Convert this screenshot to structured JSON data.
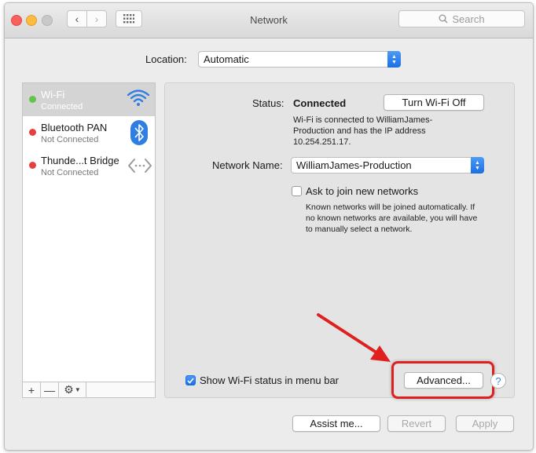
{
  "window": {
    "title": "Network"
  },
  "search": {
    "placeholder": "Search"
  },
  "location": {
    "label": "Location:",
    "value": "Automatic"
  },
  "services": [
    {
      "name": "Wi-Fi",
      "status": "Connected",
      "dot_color": "#5fc54b",
      "icon": "wifi-icon"
    },
    {
      "name": "Bluetooth PAN",
      "status": "Not Connected",
      "dot_color": "#e5403b",
      "icon": "bluetooth-icon"
    },
    {
      "name": "Thunde...t Bridge",
      "status": "Not Connected",
      "dot_color": "#e5403b",
      "icon": "thunderbolt-bridge-icon"
    }
  ],
  "sidebar_footer": {
    "add": "+",
    "remove": "—",
    "gear": "⚙︎"
  },
  "detail": {
    "status_label": "Status:",
    "status_value": "Connected",
    "turn_off_button": "Turn Wi-Fi Off",
    "status_desc": [
      "Wi-Fi is connected to WilliamJames-",
      "Production and has the IP address",
      "10.254.251.17."
    ],
    "network_name_label": "Network Name:",
    "network_name_value": "WilliamJames-Production",
    "ask_to_join_label": "Ask to join new networks",
    "ask_to_join_checked": false,
    "ask_desc": [
      "Known networks will be joined automatically. If",
      "no known networks are available, you will have",
      "to manually select a network."
    ],
    "show_status_label": "Show Wi-Fi status in menu bar",
    "show_status_checked": true,
    "advanced_button": "Advanced...",
    "help": "?"
  },
  "footer": {
    "assist": "Assist me...",
    "revert": "Revert",
    "apply": "Apply"
  },
  "colors": {
    "accent": "#1b6ee8",
    "highlight": "#e0201e",
    "selection": "#d4d4d4"
  }
}
